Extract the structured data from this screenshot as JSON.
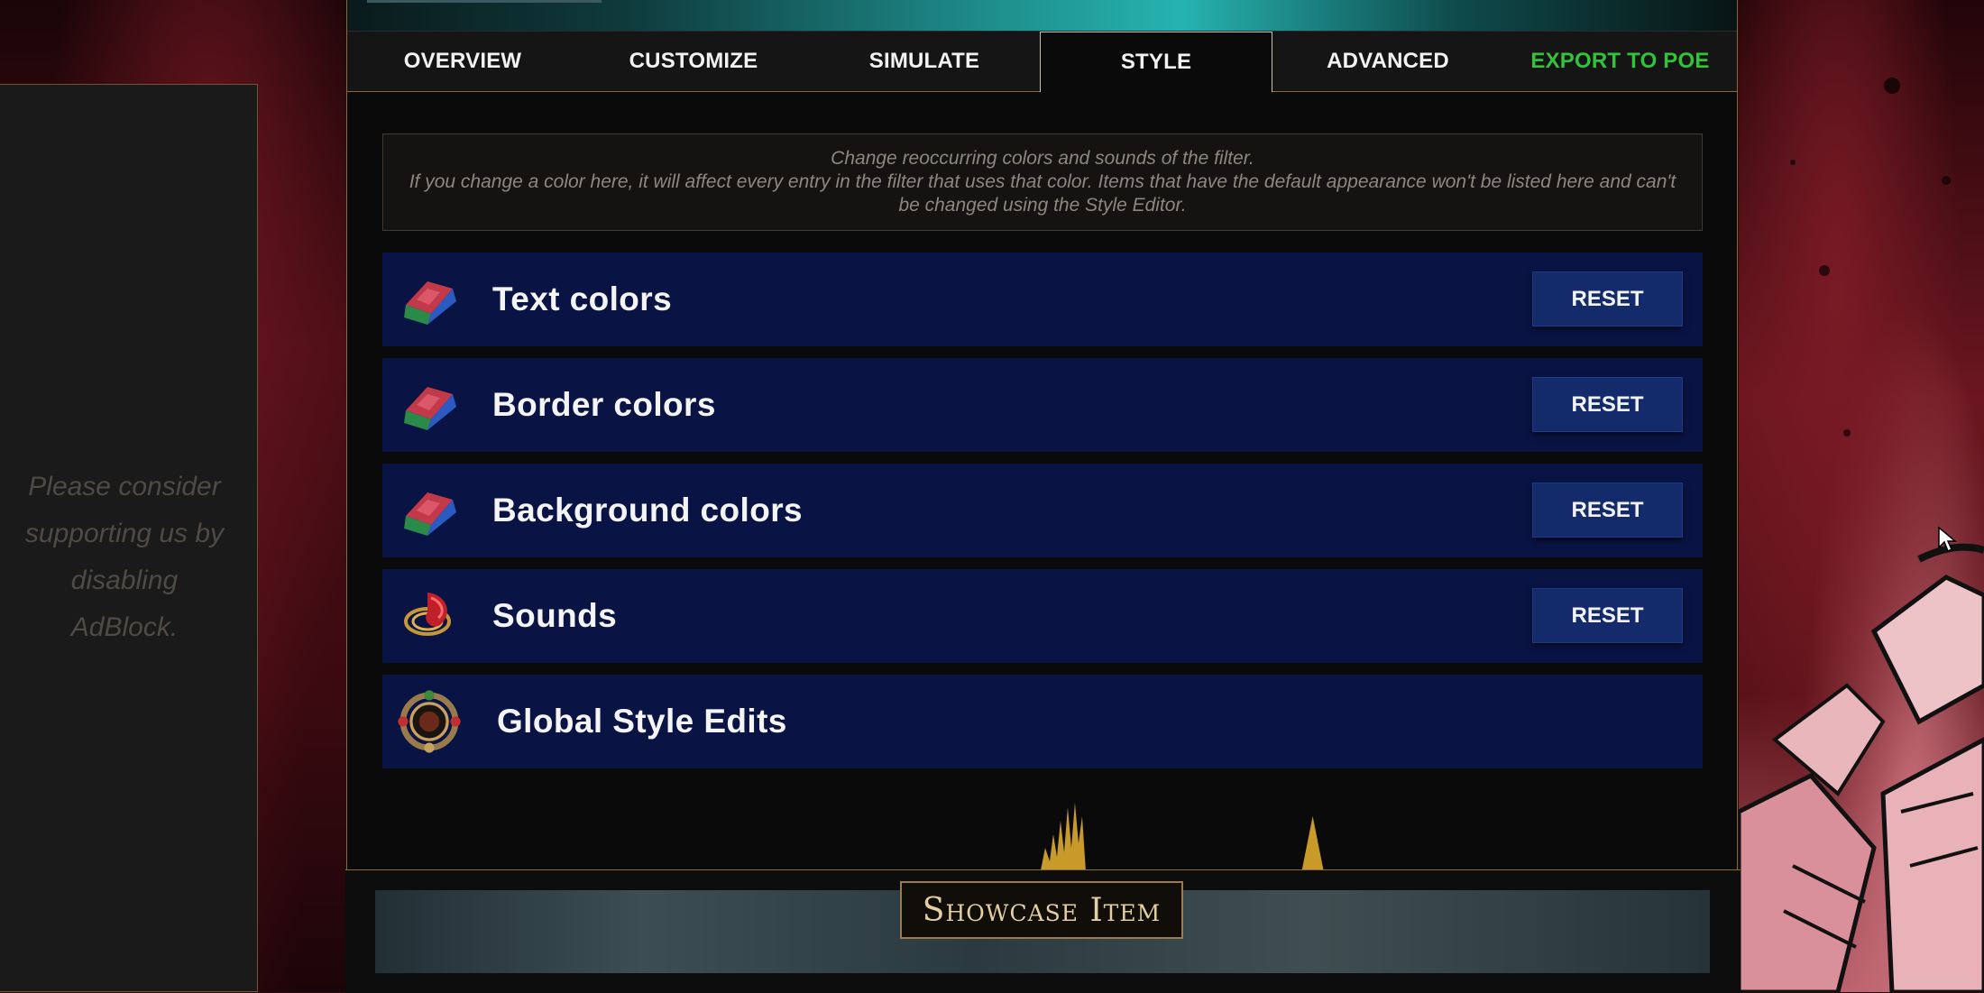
{
  "tabs": [
    {
      "label": "OVERVIEW"
    },
    {
      "label": "CUSTOMIZE"
    },
    {
      "label": "SIMULATE"
    },
    {
      "label": "STYLE",
      "active": true
    },
    {
      "label": "ADVANCED"
    },
    {
      "label": "EXPORT TO POE"
    }
  ],
  "ad": {
    "message": "Please consider supporting us by disabling AdBlock."
  },
  "info": {
    "line1": "Change reoccurring colors and sounds of the filter.",
    "line2": "If you change a color here, it will affect every entry in the filter that uses that color. Items that have the default appearance won't be listed here and can't be changed using the Style Editor."
  },
  "sections": [
    {
      "label": "Text colors",
      "icon": "chromatic-orb-icon",
      "reset_label": "RESET"
    },
    {
      "label": "Border colors",
      "icon": "chromatic-orb-icon",
      "reset_label": "RESET"
    },
    {
      "label": "Background colors",
      "icon": "chromatic-orb-icon",
      "reset_label": "RESET"
    },
    {
      "label": "Sounds",
      "icon": "sound-gem-icon",
      "reset_label": "RESET"
    },
    {
      "label": "Global Style Edits",
      "icon": "amulet-icon"
    }
  ],
  "showcase": {
    "label": "Showcase Item"
  },
  "colors": {
    "accent_gold": "#8a6a3c",
    "row_bg": "#0a1444",
    "button_bg": "#132a6b",
    "export_green": "#33c23a"
  }
}
